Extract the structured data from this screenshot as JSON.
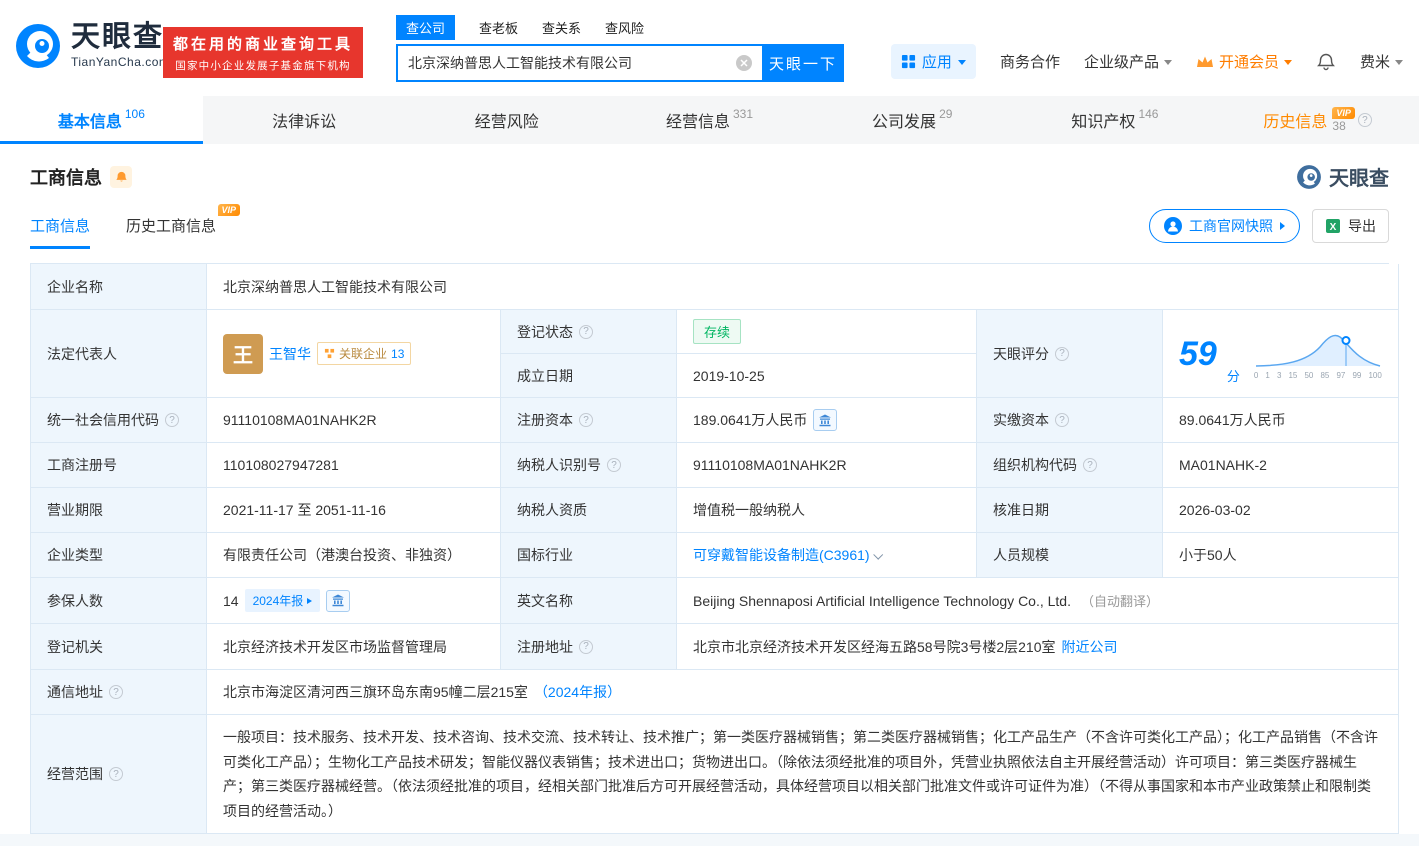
{
  "colors": {
    "brand_blue": "#0084ff",
    "brand_red": "#e7362d",
    "vip_orange": "#ff8a00",
    "status_green": "#00b561"
  },
  "icons": {
    "help": "?"
  },
  "header": {
    "logo": {
      "brand": "天眼查",
      "domain": "TianYanCha.com"
    },
    "slogan": {
      "line1": "都在用的商业查询工具",
      "line2": "国家中小企业发展子基金旗下机构"
    },
    "search_tabs": [
      {
        "label": "查公司"
      },
      {
        "label": "查老板"
      },
      {
        "label": "查关系"
      },
      {
        "label": "查风险"
      }
    ],
    "search": {
      "value": "北京深纳普思人工智能技术有限公司",
      "button": "天眼一下"
    },
    "nav": {
      "apps": "应用",
      "cooperation": "商务合作",
      "enterprise": "企业级产品",
      "vip": "开通会员",
      "user": "费米"
    }
  },
  "tabs": [
    {
      "label": "基本信息",
      "count": "106"
    },
    {
      "label": "法律诉讼",
      "count": ""
    },
    {
      "label": "经营风险",
      "count": ""
    },
    {
      "label": "经营信息",
      "count": "331"
    },
    {
      "label": "公司发展",
      "count": "29"
    },
    {
      "label": "知识产权",
      "count": "146"
    },
    {
      "label": "历史信息",
      "count": "38"
    }
  ],
  "section": {
    "title": "工商信息",
    "watermark": "天眼查",
    "subtab_current": "工商信息",
    "subtab_history": "历史工商信息",
    "vip_badge": "VIP",
    "snapshot_button": "工商官网快照",
    "export_button": "导出"
  },
  "table": {
    "company_name": {
      "label": "企业名称",
      "value": "北京深纳普思人工智能技术有限公司"
    },
    "legal_rep": {
      "label": "法定代表人",
      "avatar": "王",
      "name": "王智华",
      "related_label": "关联企业",
      "related_count": "13"
    },
    "reg_status": {
      "label": "登记状态",
      "value": "存续"
    },
    "establish_date": {
      "label": "成立日期",
      "value": "2019-10-25"
    },
    "score": {
      "label": "天眼评分",
      "value": "59",
      "unit": "分",
      "axis": [
        "0",
        "1",
        "3",
        "15",
        "50",
        "85",
        "97",
        "99",
        "100"
      ]
    },
    "credit_code": {
      "label": "统一社会信用代码",
      "value": "91110108MA01NAHK2R"
    },
    "reg_capital": {
      "label": "注册资本",
      "value": "189.0641万人民币"
    },
    "paid_capital": {
      "label": "实缴资本",
      "value": "89.0641万人民币"
    },
    "reg_number": {
      "label": "工商注册号",
      "value": "110108027947281"
    },
    "taxpayer_id": {
      "label": "纳税人识别号",
      "value": "91110108MA01NAHK2R"
    },
    "org_code": {
      "label": "组织机构代码",
      "value": "MA01NAHK-2"
    },
    "business_term": {
      "label": "营业期限",
      "value": "2021-11-17 至 2051-11-16"
    },
    "taxpayer_qualification": {
      "label": "纳税人资质",
      "value": "增值税一般纳税人"
    },
    "approval_date": {
      "label": "核准日期",
      "value": "2026-03-02"
    },
    "company_type": {
      "label": "企业类型",
      "value": "有限责任公司（港澳台投资、非独资）"
    },
    "industry": {
      "label": "国标行业",
      "value": "可穿戴智能设备制造(C3961)"
    },
    "staff_size": {
      "label": "人员规模",
      "value": "小于50人"
    },
    "insured": {
      "label": "参保人数",
      "value": "14",
      "badge": "2024年报"
    },
    "english_name": {
      "label": "英文名称",
      "value": "Beijing Shennaposi Artificial Intelligence Technology Co., Ltd.",
      "note": "（自动翻译）"
    },
    "reg_authority": {
      "label": "登记机关",
      "value": "北京经济技术开发区市场监督管理局"
    },
    "reg_address": {
      "label": "注册地址",
      "value": "北京市北京经济技术开发区经海五路58号院3号楼2层210室",
      "link": "附近公司"
    },
    "mail_address": {
      "label": "通信地址",
      "value": "北京市海淀区清河西三旗环岛东南95幢二层215室",
      "link": "（2024年报）"
    },
    "business_scope": {
      "label": "经营范围",
      "value": "一般项目：技术服务、技术开发、技术咨询、技术交流、技术转让、技术推广；第一类医疗器械销售；第二类医疗器械销售；化工产品生产（不含许可类化工产品）；化工产品销售（不含许可类化工产品）；生物化工产品技术研发；智能仪器仪表销售；技术进出口；货物进出口。（除依法须经批准的项目外，凭营业执照依法自主开展经营活动）许可项目：第三类医疗器械生产；第三类医疗器械经营。（依法须经批准的项目，经相关部门批准后方可开展经营活动，具体经营项目以相关部门批准文件或许可证件为准）（不得从事国家和本市产业政策禁止和限制类项目的经营活动。）"
    }
  }
}
